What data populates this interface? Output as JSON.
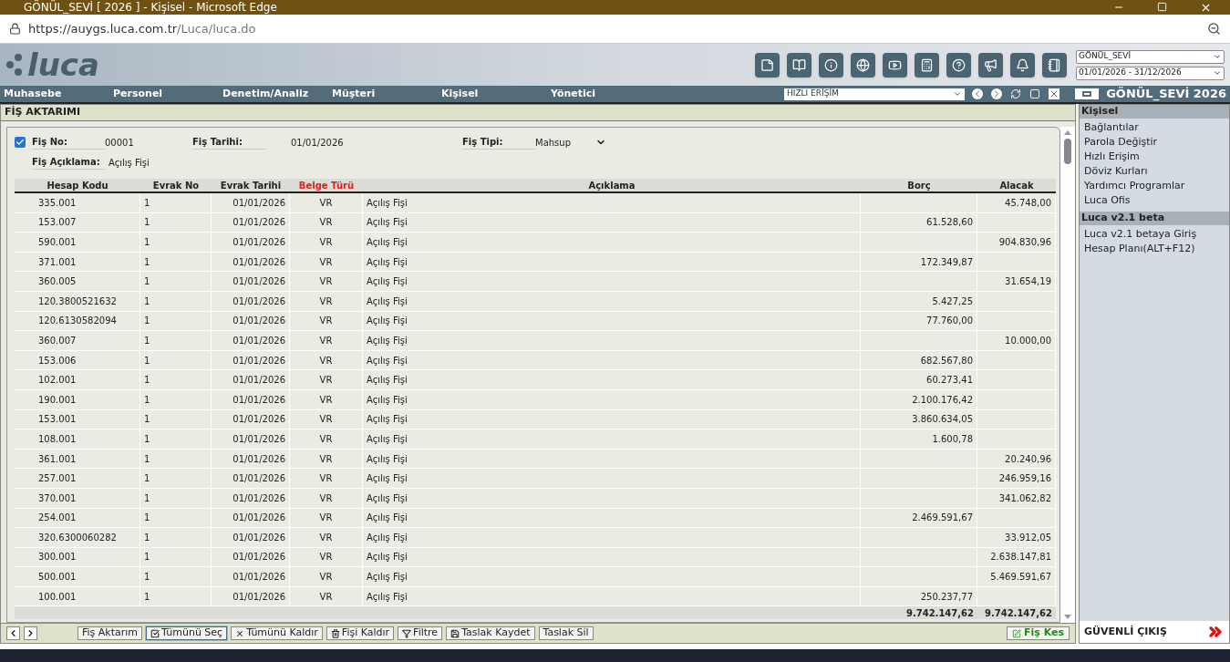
{
  "window": {
    "title": "GÖNÜL_SEVİ [ 2026 ] - Kişisel - Microsoft Edge"
  },
  "address_bar": {
    "url_host": "https://auygs.luca.com.tr",
    "url_path": "/Luca/luca.do"
  },
  "header": {
    "logo": "luca",
    "company_select": "GÖNÜL_SEVİ",
    "period_select": "01/01/2026 - 31/12/2026"
  },
  "nav": {
    "items": [
      "Muhasebe",
      "Personel",
      "Denetim/Analiz",
      "Müşteri",
      "Kişisel",
      "Yönetici"
    ],
    "quick_access": "HIZLI ERİŞİM",
    "user_title": "GÖNÜL_SEVİ 2026"
  },
  "panel": {
    "title": "FİŞ AKTARIMI",
    "form": {
      "checked": true,
      "fis_no_label": "Fiş No:",
      "fis_no": "00001",
      "fis_tarihi_label": "Fiş Tarihi:",
      "fis_tarihi": "01/01/2026",
      "fis_tipi_label": "Fiş Tipi:",
      "fis_tipi": "Mahsup",
      "aciklama_label": "Fiş Açıklama:",
      "aciklama": "Açılış Fişi"
    },
    "table": {
      "columns": [
        {
          "label": "Hesap Kodu",
          "highlight": false
        },
        {
          "label": "Evrak No",
          "highlight": false
        },
        {
          "label": "Evrak Tarihi",
          "highlight": false
        },
        {
          "label": "Belge Türü",
          "highlight": true
        },
        {
          "label": "Açıklama",
          "highlight": false
        },
        {
          "label": "Borç",
          "highlight": false
        },
        {
          "label": "Alacak",
          "highlight": false
        }
      ],
      "rows": [
        [
          "335.001",
          "1",
          "01/01/2026",
          "VR",
          "Açılış Fişi",
          "",
          "45.748,00"
        ],
        [
          "153.007",
          "1",
          "01/01/2026",
          "VR",
          "Açılış Fişi",
          "61.528,60",
          ""
        ],
        [
          "590.001",
          "1",
          "01/01/2026",
          "VR",
          "Açılış Fişi",
          "",
          "904.830,96"
        ],
        [
          "371.001",
          "1",
          "01/01/2026",
          "VR",
          "Açılış Fişi",
          "172.349,87",
          ""
        ],
        [
          "360.005",
          "1",
          "01/01/2026",
          "VR",
          "Açılış Fişi",
          "",
          "31.654,19"
        ],
        [
          "120.3800521632",
          "1",
          "01/01/2026",
          "VR",
          "Açılış Fişi",
          "5.427,25",
          ""
        ],
        [
          "120.6130582094",
          "1",
          "01/01/2026",
          "VR",
          "Açılış Fişi",
          "77.760,00",
          ""
        ],
        [
          "360.007",
          "1",
          "01/01/2026",
          "VR",
          "Açılış Fişi",
          "",
          "10.000,00"
        ],
        [
          "153.006",
          "1",
          "01/01/2026",
          "VR",
          "Açılış Fişi",
          "682.567,80",
          ""
        ],
        [
          "102.001",
          "1",
          "01/01/2026",
          "VR",
          "Açılış Fişi",
          "60.273,41",
          ""
        ],
        [
          "190.001",
          "1",
          "01/01/2026",
          "VR",
          "Açılış Fişi",
          "2.100.176,42",
          ""
        ],
        [
          "153.001",
          "1",
          "01/01/2026",
          "VR",
          "Açılış Fişi",
          "3.860.634,05",
          ""
        ],
        [
          "108.001",
          "1",
          "01/01/2026",
          "VR",
          "Açılış Fişi",
          "1.600,78",
          ""
        ],
        [
          "361.001",
          "1",
          "01/01/2026",
          "VR",
          "Açılış Fişi",
          "",
          "20.240,96"
        ],
        [
          "257.001",
          "1",
          "01/01/2026",
          "VR",
          "Açılış Fişi",
          "",
          "246.959,16"
        ],
        [
          "370.001",
          "1",
          "01/01/2026",
          "VR",
          "Açılış Fişi",
          "",
          "341.062,82"
        ],
        [
          "254.001",
          "1",
          "01/01/2026",
          "VR",
          "Açılış Fişi",
          "2.469.591,67",
          ""
        ],
        [
          "320.6300060282",
          "1",
          "01/01/2026",
          "VR",
          "Açılış Fişi",
          "",
          "33.912,05"
        ],
        [
          "300.001",
          "1",
          "01/01/2026",
          "VR",
          "Açılış Fişi",
          "",
          "2.638.147,81"
        ],
        [
          "500.001",
          "1",
          "01/01/2026",
          "VR",
          "Açılış Fişi",
          "",
          "5.469.591,67"
        ],
        [
          "100.001",
          "1",
          "01/01/2026",
          "VR",
          "Açılış Fişi",
          "250.237,77",
          ""
        ]
      ],
      "totals": {
        "borc": "9.742.147,62",
        "alacak": "9.742.147,62"
      }
    },
    "buttons": [
      {
        "label": "Fiş Aktarım",
        "selected": false
      },
      {
        "label": "Tümünü Seç",
        "selected": true
      },
      {
        "label": "Tümünü Kaldır",
        "selected": false
      },
      {
        "label": "Fişi Kaldır",
        "selected": false
      },
      {
        "label": "Filtre",
        "selected": false
      },
      {
        "label": "Taslak Kaydet",
        "selected": false
      },
      {
        "label": "Taslak Sil",
        "selected": false
      }
    ],
    "primary_button": "Fiş Kes"
  },
  "sidebar": {
    "sections": [
      {
        "title": "Kişisel",
        "items": [
          "Bağlantılar",
          "Parola Değiştir",
          "Hızlı Erişim",
          "Döviz Kurları",
          "Yardımcı Programlar",
          "Luca Ofis"
        ]
      },
      {
        "title": "Luca v2.1 beta",
        "items": [
          "Luca v2.1 betaya Giriş",
          "Hesap Planı(ALT+F12)"
        ]
      }
    ],
    "logout": "GÜVENLİ ÇIKIŞ"
  }
}
